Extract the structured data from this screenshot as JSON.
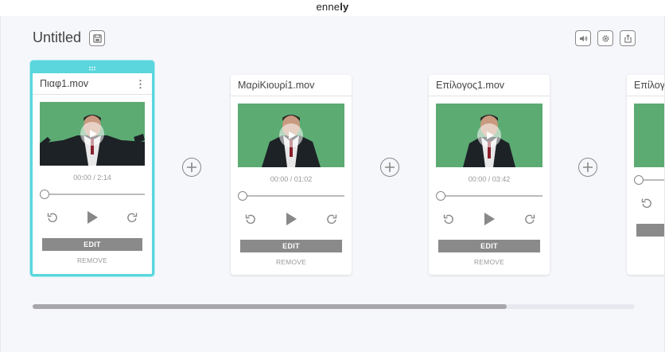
{
  "brand": {
    "prefix": "enne",
    "suffix": "ly"
  },
  "project": {
    "title": "Untitled"
  },
  "toolbar": {
    "icons": [
      "save-icon",
      "volume-icon",
      "gear-icon",
      "share-icon"
    ]
  },
  "clips": [
    {
      "name": "Πιαφ1.mov",
      "time": "00:00 / 2:14",
      "edit_label": "EDIT",
      "remove_label": "REMOVE",
      "selected": true,
      "progress": 0
    },
    {
      "name": "ΜαρiΚιουρί1.mov",
      "time": "00:00 / 01:02",
      "edit_label": "EDIT",
      "remove_label": "REMOVE",
      "selected": false,
      "progress": 0
    },
    {
      "name": "Επίλογος1.mov",
      "time": "00:00 / 03:42",
      "edit_label": "EDIT",
      "remove_label": "REMOVE",
      "selected": false,
      "progress": 0
    },
    {
      "name": "Επίλογ",
      "time": "",
      "edit_label": "",
      "remove_label": "",
      "selected": false,
      "progress": 0
    }
  ],
  "colors": {
    "accent": "#5ad6dc",
    "video_bg": "#5cab73",
    "edit_button": "#8a8a8a"
  },
  "scrollbar": {
    "position_fraction": 0.79
  }
}
